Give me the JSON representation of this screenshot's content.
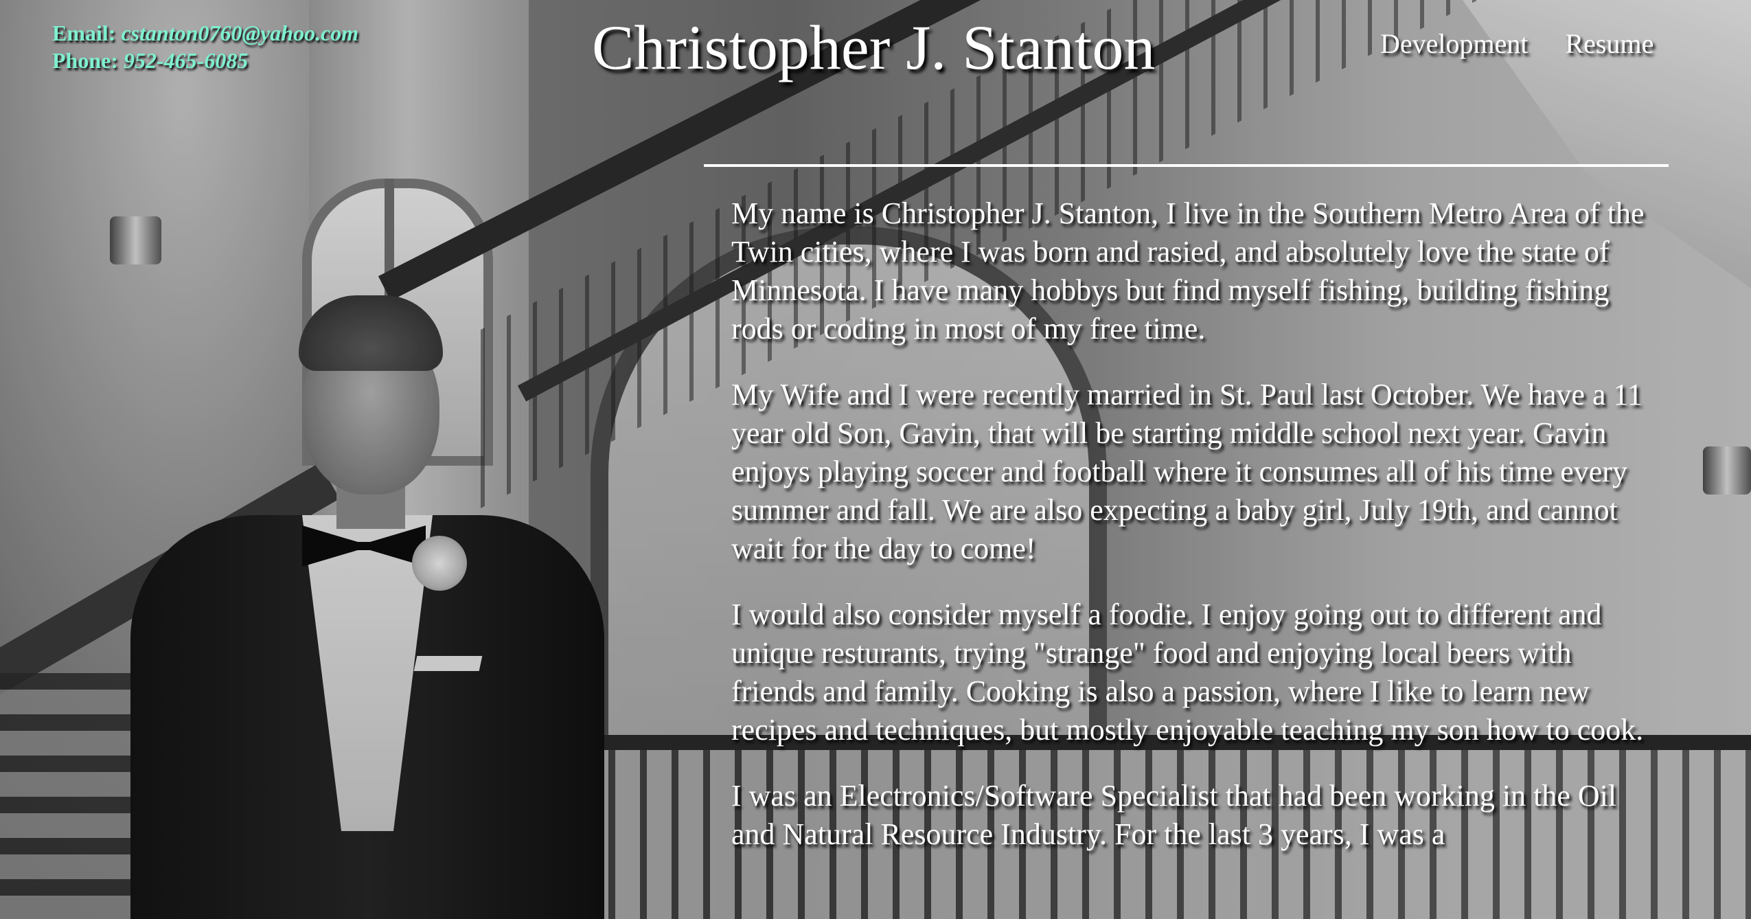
{
  "contact": {
    "email_label": "Email:",
    "email": "cstanton0760@yahoo.com",
    "phone_label": "Phone:",
    "phone": "952-465-6085"
  },
  "header": {
    "title": "Christopher J. Stanton"
  },
  "nav": {
    "items": [
      {
        "label": "Development"
      },
      {
        "label": "Resume"
      }
    ]
  },
  "bio": {
    "paragraphs": [
      "My name is Christopher J. Stanton, I live in the Southern Metro Area of the Twin cities, where I was born and rasied, and absolutely love the state of Minnesota. I have many hobbys but find myself fishing, building fishing rods or coding in most of my free time.",
      "My Wife and I were recently married in St. Paul last October. We have a 11 year old Son, Gavin, that will be starting middle school next year. Gavin enjoys playing soccer and football where it consumes all of his time every summer and fall. We are also expecting a baby girl, July 19th, and cannot wait for the day to come!",
      "I would also consider myself a foodie. I enjoy going out to different and unique resturants, trying \"strange\" food and enjoying local beers with friends and family. Cooking is also a passion, where I like to learn new recipes and techniques, but mostly enjoyable teaching my son how to cook.",
      "I was an Electronics/Software Specialist that had been working in the Oil and Natural Resource Industry. For the last 3 years, I was a"
    ]
  },
  "colors": {
    "contact_text": "#7ff0d0",
    "text": "#ffffff",
    "text_shadow": "#000000"
  }
}
